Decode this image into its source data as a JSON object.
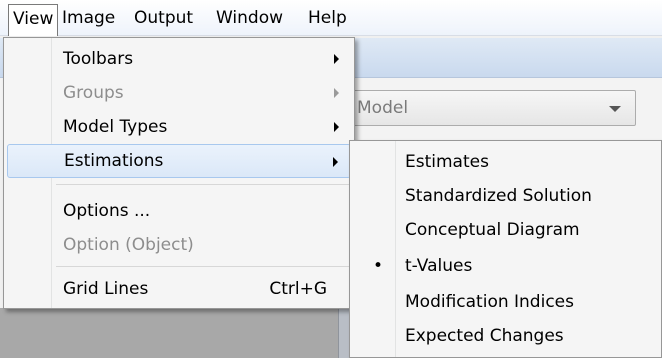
{
  "menubar": {
    "items": [
      {
        "label": "View"
      },
      {
        "label": "Image"
      },
      {
        "label": "Output"
      },
      {
        "label": "Window"
      },
      {
        "label": "Help"
      }
    ]
  },
  "background": {
    "combo_value": "Model"
  },
  "view_menu": {
    "items": [
      {
        "label": "Toolbars"
      },
      {
        "label": "Groups"
      },
      {
        "label": "Model Types"
      },
      {
        "label": "Estimations"
      },
      {
        "label": "Options ..."
      },
      {
        "label": "Option (Object)"
      },
      {
        "label": "Grid Lines",
        "shortcut": "Ctrl+G"
      }
    ]
  },
  "estimations_submenu": {
    "bullet": "•",
    "items": [
      {
        "label": "Estimates"
      },
      {
        "label": "Standardized Solution"
      },
      {
        "label": "Conceptual Diagram"
      },
      {
        "label": "t-Values"
      },
      {
        "label": "Modification Indices"
      },
      {
        "label": "Expected Changes"
      }
    ]
  }
}
